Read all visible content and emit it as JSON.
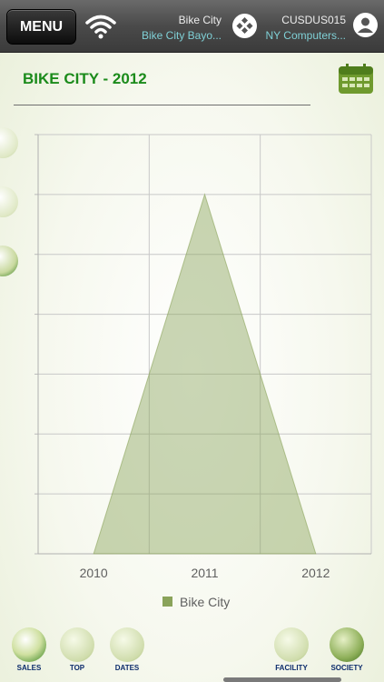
{
  "header": {
    "menu_label": "MENU",
    "site_name": "Bike City",
    "site_sub": "Bike City Bayo...",
    "customer_code": "CUSDUS015",
    "customer_sub": "NY Computers..."
  },
  "page": {
    "title": "BIKE CITY - 2012"
  },
  "chart_data": {
    "type": "area",
    "categories": [
      "2010",
      "2011",
      "2012"
    ],
    "series": [
      {
        "name": "Bike City",
        "values": [
          0,
          6.0,
          0
        ],
        "color": "#8aa35a"
      }
    ],
    "ylim": [
      0,
      7
    ],
    "grid": true,
    "legend": "bottom"
  },
  "bottom_nav": {
    "sales_label": "SALES",
    "top_label": "TOP",
    "dates_label": "DATES",
    "facility_label": "FACILITY",
    "society_label": "SOCIETY"
  },
  "colors": {
    "accent": "#1b8b1b",
    "header_sub": "#7fd0d6",
    "series": "#8aa35a"
  }
}
